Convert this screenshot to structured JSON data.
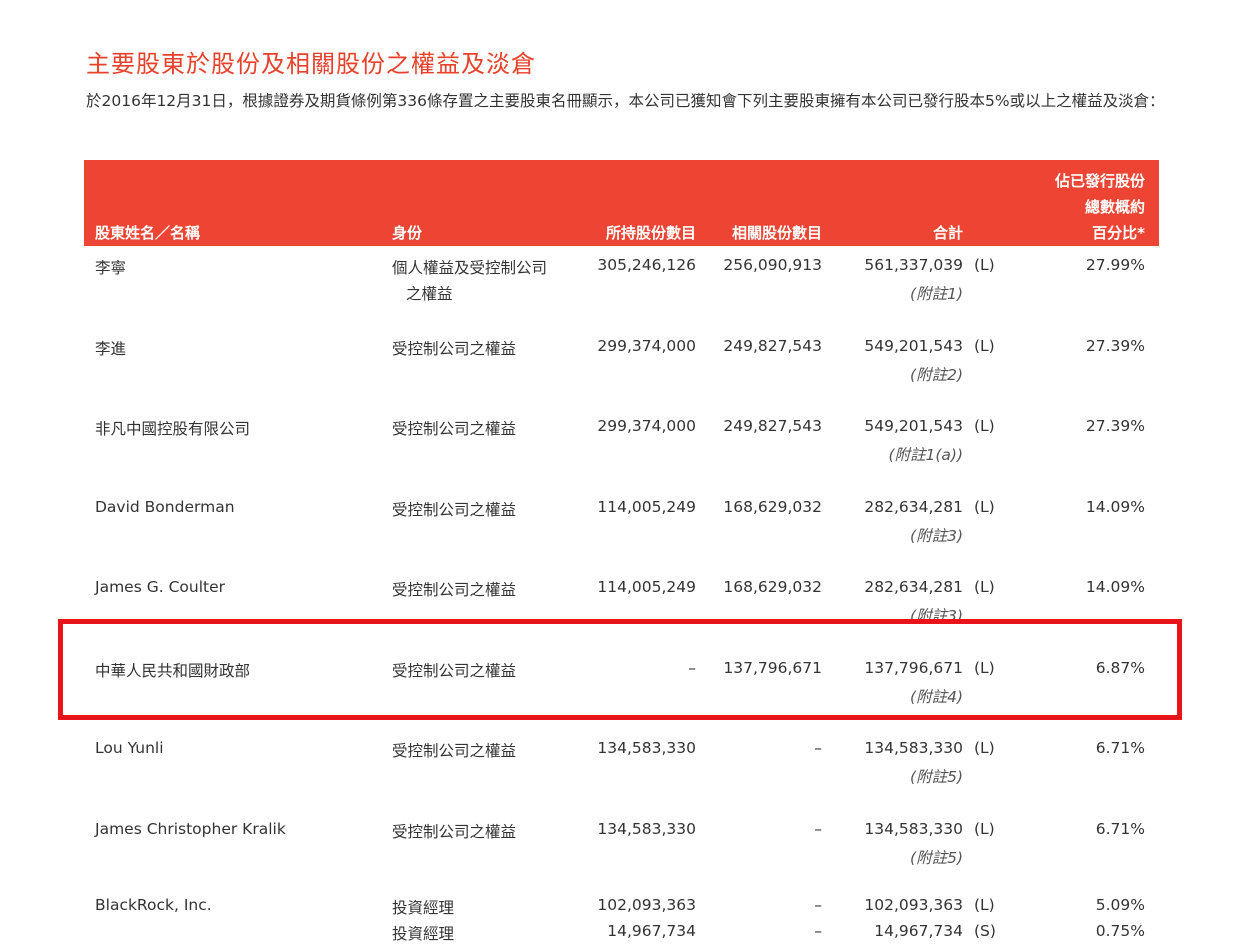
{
  "title": "主要股東於股份及相關股份之權益及淡倉",
  "intro": "於2016年12月31日，根據證券及期貨條例第336條存置之主要股東名冊顯示，本公司已獲知會下列主要股東擁有本公司已發行股本5%或以上之權益及淡倉：",
  "table": {
    "headers": {
      "name": "股東姓名／名稱",
      "capacity": "身份",
      "shares": "所持股份數目",
      "related": "相關股份數目",
      "total": "合計",
      "percent_line1": "佔已發行股份",
      "percent_line2": "總數概約",
      "percent_line3": "百分比*"
    },
    "rows": [
      {
        "name": "李寧",
        "capacity": "個人權益及受控制公司",
        "capacity2": "之權益",
        "shares": "305,246,126",
        "related": "256,090,913",
        "total": "561,337,039",
        "label": "(L)",
        "note": "(附註1)",
        "percent": "27.99%"
      },
      {
        "name": "李進",
        "capacity": "受控制公司之權益",
        "capacity2": "",
        "shares": "299,374,000",
        "related": "249,827,543",
        "total": "549,201,543",
        "label": "(L)",
        "note": "(附註2)",
        "percent": "27.39%"
      },
      {
        "name": "非凡中國控股有限公司",
        "capacity": "受控制公司之權益",
        "capacity2": "",
        "shares": "299,374,000",
        "related": "249,827,543",
        "total": "549,201,543",
        "label": "(L)",
        "note": "(附註1(a))",
        "percent": "27.39%"
      },
      {
        "name": "David Bonderman",
        "capacity": "受控制公司之權益",
        "capacity2": "",
        "shares": "114,005,249",
        "related": "168,629,032",
        "total": "282,634,281",
        "label": "(L)",
        "note": "(附註3)",
        "percent": "14.09%"
      },
      {
        "name": "James G. Coulter",
        "capacity": "受控制公司之權益",
        "capacity2": "",
        "shares": "114,005,249",
        "related": "168,629,032",
        "total": "282,634,281",
        "label": "(L)",
        "note": "(附註3)",
        "percent": "14.09%"
      },
      {
        "name": "中華人民共和國財政部",
        "capacity": "受控制公司之權益",
        "capacity2": "",
        "shares": "–",
        "related": "137,796,671",
        "total": "137,796,671",
        "label": "(L)",
        "note": "(附註4)",
        "percent": "6.87%"
      },
      {
        "name": "Lou Yunli",
        "capacity": "受控制公司之權益",
        "capacity2": "",
        "shares": "134,583,330",
        "related": "–",
        "total": "134,583,330",
        "label": "(L)",
        "note": "(附註5)",
        "percent": "6.71%"
      },
      {
        "name": "James Christopher Kralik",
        "capacity": "受控制公司之權益",
        "capacity2": "",
        "shares": "134,583,330",
        "related": "–",
        "total": "134,583,330",
        "label": "(L)",
        "note": "(附註5)",
        "percent": "6.71%"
      }
    ],
    "blackrock": {
      "name": "BlackRock, Inc.",
      "line1": {
        "capacity": "投資經理",
        "shares": "102,093,363",
        "related": "–",
        "total": "102,093,363",
        "label": "(L)",
        "percent": "5.09%"
      },
      "line2": {
        "capacity": "投資經理",
        "shares": "14,967,734",
        "related": "–",
        "total": "14,967,734",
        "label": "(S)",
        "percent": "0.75%"
      }
    }
  },
  "colors": {
    "header_bg": "#ee4433",
    "title": "#e8402a",
    "highlight": "#e8141a"
  }
}
